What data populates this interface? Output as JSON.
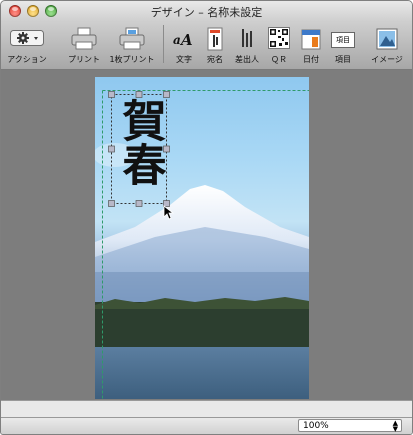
{
  "window": {
    "title": "デザイン – 名称未設定"
  },
  "toolbar": {
    "items": [
      {
        "label": "アクション",
        "icon": "gear-icon"
      },
      {
        "label": "プリント",
        "icon": "printer-icon"
      },
      {
        "label": "1枚プリント",
        "icon": "single-print-icon"
      },
      {
        "label": "文字",
        "icon": "text-icon"
      },
      {
        "label": "宛名",
        "icon": "address-icon"
      },
      {
        "label": "差出人",
        "icon": "sender-icon"
      },
      {
        "label": "ＱＲ",
        "icon": "qr-icon"
      },
      {
        "label": "日付",
        "icon": "calendar-icon"
      },
      {
        "label": "項目",
        "icon": "field-icon"
      },
      {
        "label": "イメージ",
        "icon": "image-icon"
      }
    ],
    "field_icon_text": "項目"
  },
  "card": {
    "text": "賀春"
  },
  "status": {
    "zoom": "100%"
  },
  "colors": {
    "guide": "#2f9a6a",
    "card_sky": "#a9d8f5",
    "water": "#496b87"
  }
}
